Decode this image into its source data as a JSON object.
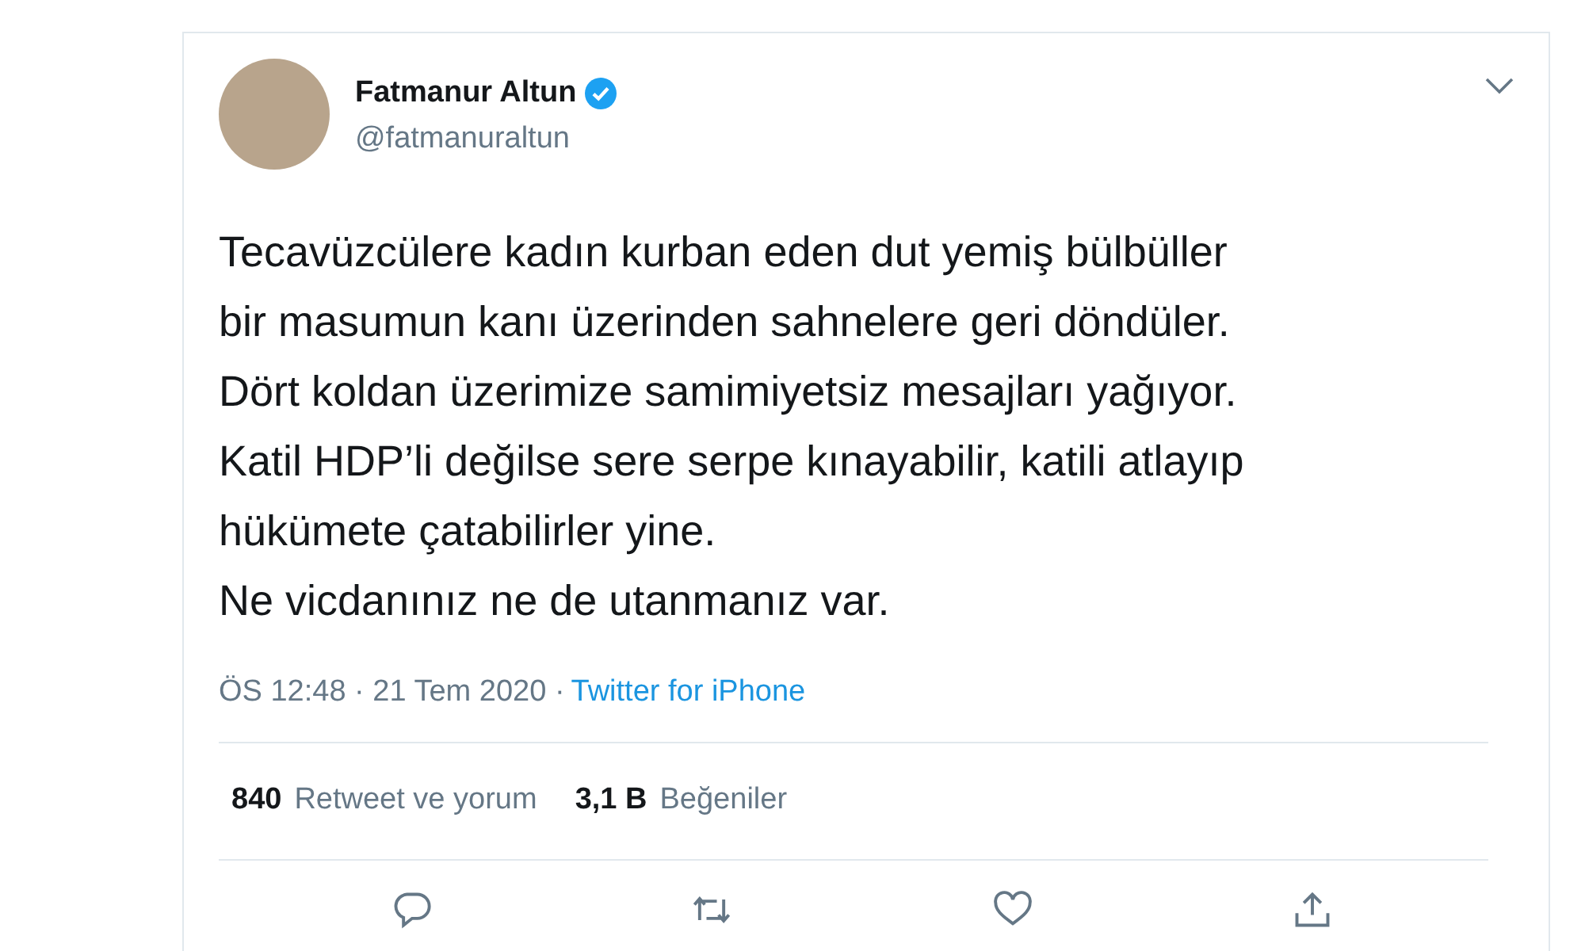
{
  "tweet": {
    "name": "Fatmanur Altun",
    "verified": true,
    "handle": "@fatmanuraltun",
    "text_lines": [
      "Tecavüzcülere kadın kurban eden dut yemiş bülbüller",
      "bir masumun kanı üzerinden sahnelere geri döndüler.",
      "Dört koldan üzerimize samimiyetsiz mesajları yağıyor.",
      "Katil HDP’li değilse sere serpe kınayabilir, katili atlayıp",
      "hükümete çatabilirler yine.",
      "Ne vicdanınız ne de utanmanız var."
    ],
    "meta": "ÖS 12:48 · 21 Tem 2020 ·",
    "source": "Twitter for iPhone",
    "stats": [
      {
        "count": "840",
        "label": "Retweet ve yorum"
      },
      {
        "count": "3,1 B",
        "label": "Beğeniler"
      }
    ],
    "actions": [
      {
        "kind": "reply"
      },
      {
        "kind": "retweet"
      },
      {
        "kind": "like"
      },
      {
        "kind": "share"
      }
    ]
  }
}
